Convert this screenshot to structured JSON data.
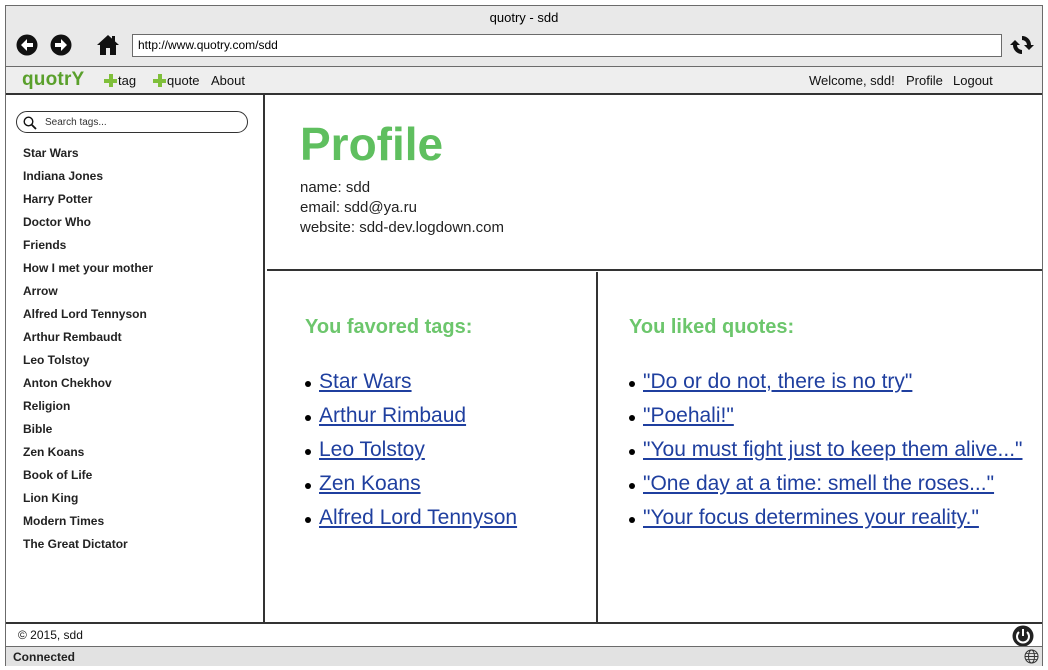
{
  "window": {
    "title": "quotry - sdd"
  },
  "browser": {
    "url": "http://www.quotry.com/sdd"
  },
  "appbar": {
    "logo": "quotrY",
    "add_tag": "tag",
    "add_quote": "quote",
    "about": "About",
    "welcome": "Welcome, sdd!",
    "profile": "Profile",
    "logout": "Logout"
  },
  "sidebar": {
    "search_placeholder": "Search tags...",
    "tags": [
      "Star Wars",
      "Indiana Jones",
      "Harry Potter",
      "Doctor Who",
      "Friends",
      "How I met your mother",
      "Arrow",
      "Alfred Lord Tennyson",
      "Arthur Rembaudt",
      "Leo Tolstoy",
      "Anton Chekhov",
      "Religion",
      "Bible",
      "Zen Koans",
      "Book of Life",
      "Lion King",
      "Modern Times",
      "The Great Dictator"
    ]
  },
  "profile": {
    "title": "Profile",
    "name": "name: sdd",
    "email": "email: sdd@ya.ru",
    "website": "website: sdd-dev.logdown.com"
  },
  "favored": {
    "heading": "You favored tags:",
    "tags": [
      "Star Wars",
      "Arthur Rimbaud",
      "Leo Tolstoy",
      "Zen Koans",
      "Alfred Lord Tennyson"
    ]
  },
  "liked": {
    "heading": "You liked quotes:",
    "quotes": [
      "\"Do or do not, there is no try\"",
      "\"Poehali!\"",
      "\"You must fight just to keep them alive...\"",
      "\"One day at a time: smell the roses...\"",
      "\"Your focus determines your reality.\""
    ]
  },
  "footer": {
    "copyright": "© 2015, sdd"
  },
  "status": {
    "text": "Connected"
  },
  "icons": {
    "back": "back-arrow-icon",
    "forward": "forward-arrow-icon",
    "home": "home-icon",
    "reload": "reload-icon",
    "search": "search-icon",
    "power": "power-icon",
    "globe": "globe-icon"
  }
}
